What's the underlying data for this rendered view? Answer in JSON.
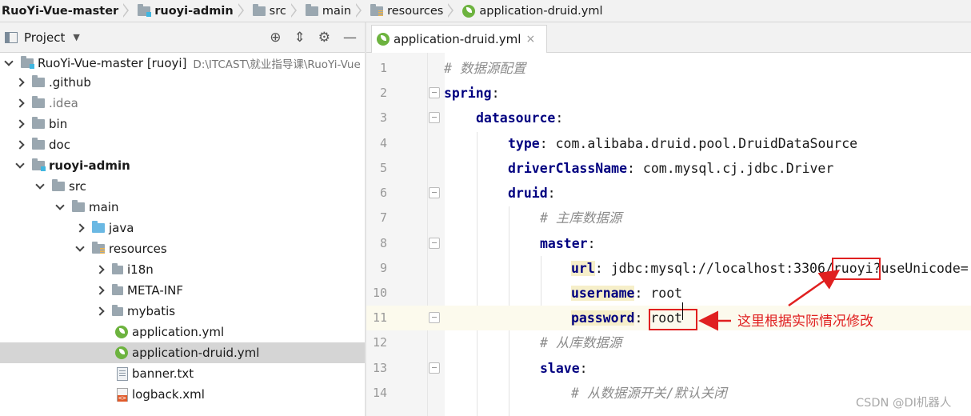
{
  "breadcrumb": [
    {
      "label": "RuoYi-Vue-master",
      "bold": true,
      "icon": "none"
    },
    {
      "label": "ruoyi-admin",
      "bold": true,
      "icon": "module-folder-icon"
    },
    {
      "label": "src",
      "bold": false,
      "icon": "folder-icon"
    },
    {
      "label": "main",
      "bold": false,
      "icon": "folder-icon"
    },
    {
      "label": "resources",
      "bold": false,
      "icon": "resources-folder-icon"
    },
    {
      "label": "application-druid.yml",
      "bold": false,
      "icon": "spring-yml-icon"
    }
  ],
  "project_panel": {
    "title": "Project",
    "tools": [
      "crosshair-icon",
      "collapse-icon",
      "gear-icon",
      "minimize-icon"
    ]
  },
  "tree": {
    "root": {
      "label": "RuoYi-Vue-master [ruoyi]",
      "path": "D:\\ITCAST\\就业指导课\\RuoYi-Vue"
    },
    "items": [
      {
        "label": ".github"
      },
      {
        "label": ".idea"
      },
      {
        "label": "bin"
      },
      {
        "label": "doc"
      },
      {
        "label": "ruoyi-admin"
      },
      {
        "label": "src"
      },
      {
        "label": "main"
      },
      {
        "label": "java"
      },
      {
        "label": "resources"
      },
      {
        "label": "i18n"
      },
      {
        "label": "META-INF"
      },
      {
        "label": "mybatis"
      },
      {
        "label": "application.yml"
      },
      {
        "label": "application-druid.yml"
      },
      {
        "label": "banner.txt"
      },
      {
        "label": "logback.xml"
      }
    ]
  },
  "editor": {
    "tab_label": "application-druid.yml",
    "tab_close": "×",
    "lines": [
      {
        "n": "1",
        "comment": "# 数据源配置"
      },
      {
        "n": "2",
        "key": "spring",
        "colon": ":"
      },
      {
        "n": "3",
        "key": "datasource",
        "colon": ":"
      },
      {
        "n": "4",
        "key": "type",
        "colon": ": ",
        "value": "com.alibaba.druid.pool.DruidDataSource"
      },
      {
        "n": "5",
        "key": "driverClassName",
        "colon": ": ",
        "value": "com.mysql.cj.jdbc.Driver"
      },
      {
        "n": "6",
        "key": "druid",
        "colon": ":"
      },
      {
        "n": "7",
        "comment": "# 主库数据源"
      },
      {
        "n": "8",
        "key": "master",
        "colon": ":"
      },
      {
        "n": "9",
        "key": "url",
        "colon": ": ",
        "value_a": "jdbc:mysql://localhost:3306/",
        "value_b": "ruoyi",
        "value_c": "?useUnicode="
      },
      {
        "n": "10",
        "key": "username",
        "colon": ": ",
        "value": "root"
      },
      {
        "n": "11",
        "key": "password",
        "colon": ": ",
        "value": "root"
      },
      {
        "n": "12",
        "comment": "# 从库数据源"
      },
      {
        "n": "13",
        "key": "slave",
        "colon": ":"
      },
      {
        "n": "14",
        "comment": "# 从数据源开关/默认关闭"
      }
    ]
  },
  "annotation": "这里根据实际情况修改",
  "watermark": "CSDN @DI机器人",
  "colors": {
    "annotation_red": "#e02020",
    "yaml_key": "#000080",
    "comment": "#8c8c8c"
  }
}
